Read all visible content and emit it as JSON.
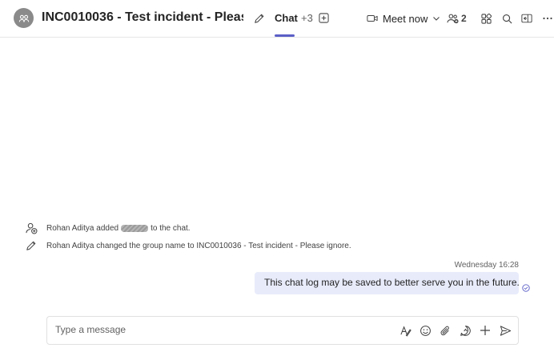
{
  "header": {
    "title": "INC0010036 - Test incident - Pleas...",
    "chat_tab_label": "Chat",
    "more_tabs_label": "+3",
    "meet_now_label": "Meet now",
    "participant_count": "2"
  },
  "system_messages": [
    {
      "icon": "person-add-icon",
      "prefix": "Rohan Aditya added",
      "suffix": "to the chat."
    },
    {
      "icon": "pencil-icon",
      "text": "Rohan Aditya changed the group name to INC0010036 - Test incident - Please ignore."
    }
  ],
  "message": {
    "timestamp": "Wednesday 16:28",
    "text": "This chat log may be saved to better serve you in the future."
  },
  "composer": {
    "placeholder": "Type a message"
  },
  "colors": {
    "accent": "#5b5fc7",
    "bubble_bg": "#e8ebfa"
  }
}
